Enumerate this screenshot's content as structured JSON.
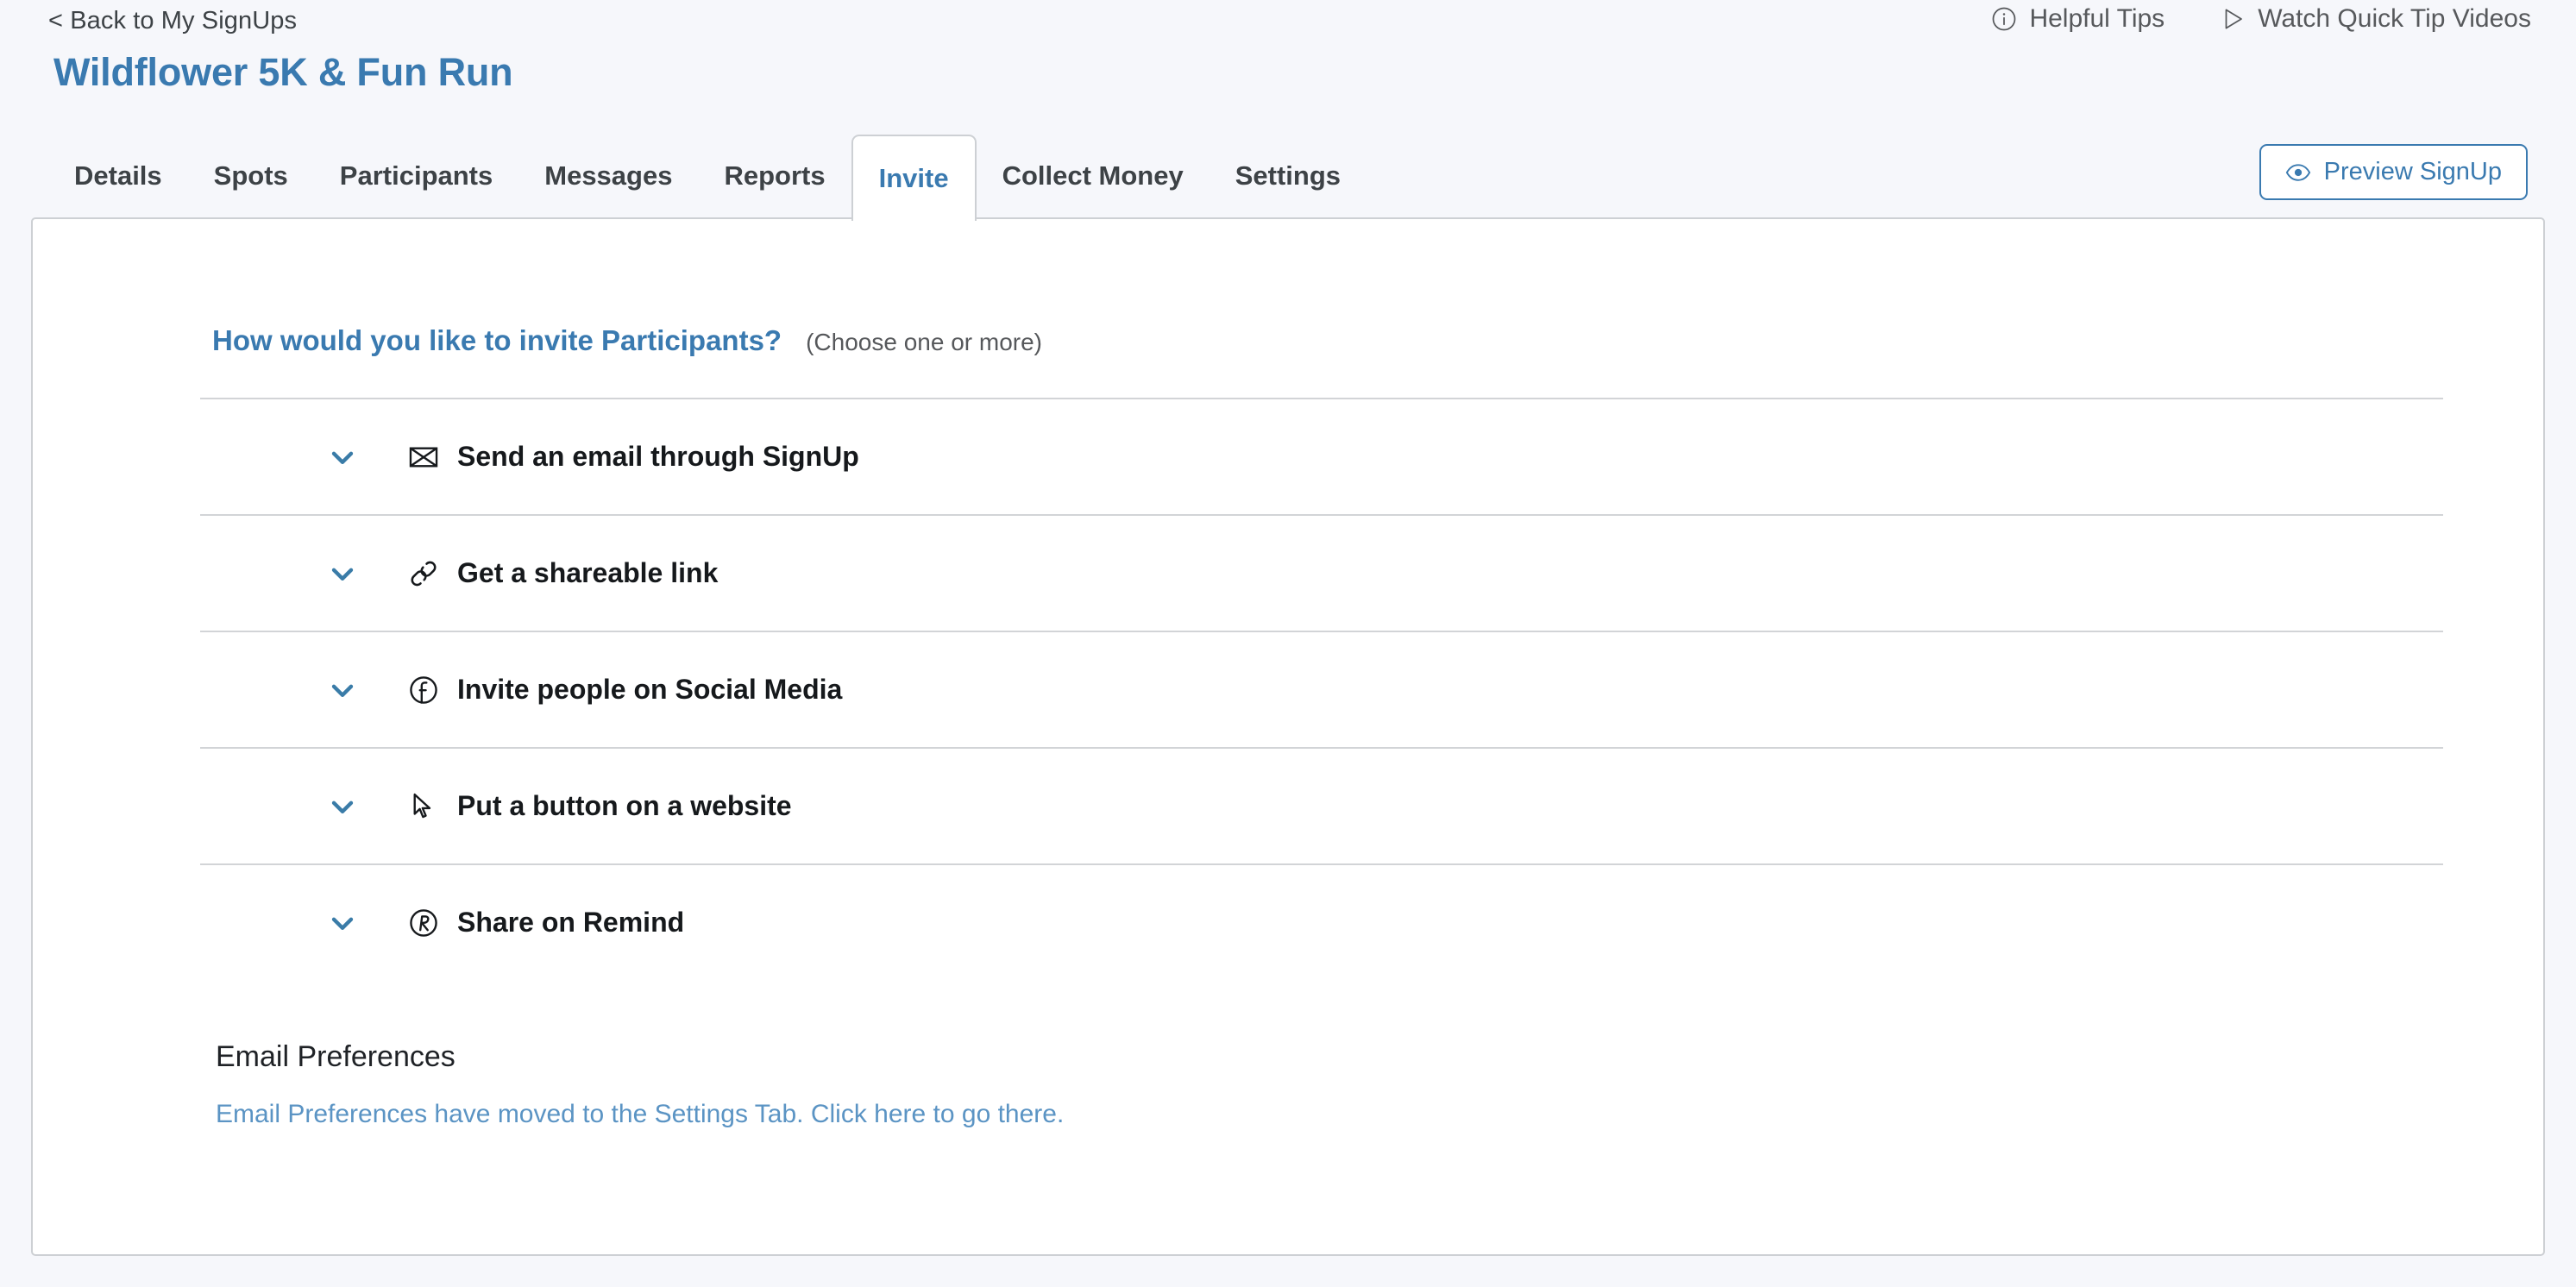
{
  "header": {
    "back_link": "< Back to My SignUps",
    "signup_title": "Wildflower 5K & Fun Run",
    "links": [
      {
        "label": "Helpful Tips",
        "icon": "info-circle-icon"
      },
      {
        "label": "Watch Quick Tip Videos",
        "icon": "play-triangle-icon"
      }
    ]
  },
  "tabs": [
    {
      "label": "Details",
      "active": false
    },
    {
      "label": "Spots",
      "active": false
    },
    {
      "label": "Participants",
      "active": false
    },
    {
      "label": "Messages",
      "active": false
    },
    {
      "label": "Reports",
      "active": false
    },
    {
      "label": "Invite",
      "active": true
    },
    {
      "label": "Collect Money",
      "active": false
    },
    {
      "label": "Settings",
      "active": false
    }
  ],
  "preview_button": {
    "label": "Preview SignUp",
    "icon": "eye-icon"
  },
  "main": {
    "question_title": "How would you like to invite Participants?",
    "question_hint": "(Choose one or more)",
    "options": [
      {
        "label": "Send an email through SignUp",
        "icon": "envelope-icon",
        "chevron": "chevron-down-icon",
        "expanded": false
      },
      {
        "label": "Get a shareable link",
        "icon": "link-icon",
        "chevron": "chevron-down-icon",
        "expanded": false
      },
      {
        "label": "Invite people on Social Media",
        "icon": "facebook-circle-icon",
        "chevron": "chevron-down-icon",
        "expanded": false
      },
      {
        "label": "Put a button on a website",
        "icon": "cursor-arrow-icon",
        "chevron": "chevron-down-icon",
        "expanded": false
      },
      {
        "label": "Share on Remind",
        "icon": "remind-circle-icon",
        "chevron": "chevron-down-icon",
        "expanded": false
      }
    ],
    "email_preferences": {
      "title": "Email Preferences",
      "link": "Email Preferences have moved to the Settings Tab. Click here to go there."
    }
  },
  "colors": {
    "accent_blue": "#3a7ab0",
    "chevron_blue": "#3a7ca8",
    "link_blue": "#5b94c4",
    "page_background": "#f6f7fb",
    "panel_border": "#cdd0d4",
    "divider": "#d2d4d7",
    "text_dark": "#16191c",
    "text_muted": "#56585b"
  }
}
